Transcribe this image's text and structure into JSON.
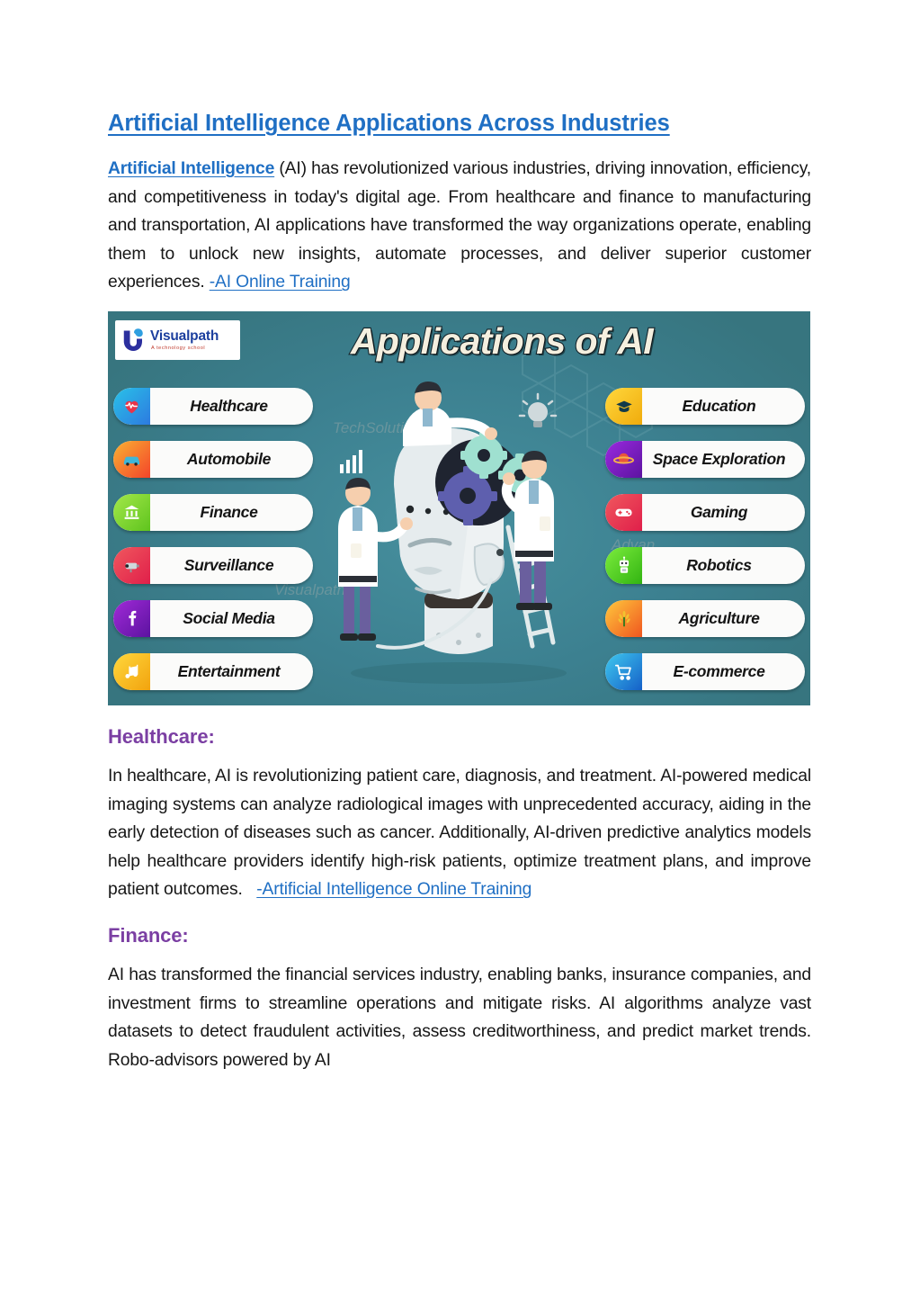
{
  "document": {
    "title": "Artificial Intelligence Applications Across Industries",
    "intro": {
      "link_lead": "Artificial Intelligence",
      "text": " (AI) has revolutionized various industries, driving innovation, efficiency, and competitiveness in today's digital age. From healthcare and finance to manufacturing and transportation, AI applications have transformed the way organizations operate, enabling them to unlock new insights, automate processes, and deliver superior customer experiences. ",
      "link_trail": "-AI Online Training"
    },
    "sections": [
      {
        "heading": "Healthcare:",
        "text": "In healthcare, AI is revolutionizing patient care, diagnosis, and treatment. AI-powered medical imaging systems can analyze radiological images with unprecedented accuracy, aiding in the early detection of diseases such as cancer. Additionally, AI-driven predictive analytics models help healthcare providers identify high-risk patients, optimize treatment plans, and improve patient outcomes.",
        "link_trail": "-Artificial Intelligence Online Training"
      },
      {
        "heading": "Finance:",
        "text": "AI has transformed the financial services industry, enabling banks, insurance companies, and investment firms to streamline operations and mitigate risks. AI algorithms analyze vast datasets to detect fraudulent activities, assess creditworthiness, and predict market trends. Robo-advisors powered by AI",
        "link_trail": ""
      }
    ]
  },
  "infographic": {
    "title": "Applications of AI",
    "logo": {
      "name": "Visualpath",
      "tagline": "A technology school",
      "mark": "v-logo-icon"
    },
    "background_color": "#3E8391",
    "left_items": [
      {
        "label": "Healthcare",
        "icon": "heart-pulse-icon",
        "color": "#1e9bd7",
        "glyph": "♥"
      },
      {
        "label": "Automobile",
        "icon": "car-icon",
        "color": "#f4622a",
        "glyph": "🚗"
      },
      {
        "label": "Finance",
        "icon": "bank-icon",
        "color": "#7ed321",
        "glyph": "🏛"
      },
      {
        "label": "Surveillance",
        "icon": "cctv-camera-icon",
        "color": "#e8344a",
        "glyph": "📹"
      },
      {
        "label": "Social Media",
        "icon": "facebook-icon",
        "color": "#7b1fa2",
        "glyph": "f"
      },
      {
        "label": "Entertainment",
        "icon": "music-note-icon",
        "color": "#f5c518",
        "glyph": "♫"
      }
    ],
    "right_items": [
      {
        "label": "Education",
        "icon": "graduation-cap-icon",
        "color": "#f9c716",
        "glyph": "🎓"
      },
      {
        "label": "Space Exploration",
        "icon": "planet-icon",
        "color": "#7d16c9",
        "glyph": "🪐"
      },
      {
        "label": "Gaming",
        "icon": "gamepad-icon",
        "color": "#e8344a",
        "glyph": "🎮"
      },
      {
        "label": "Robotics",
        "icon": "robot-icon",
        "color": "#4ecb2e",
        "glyph": "🤖"
      },
      {
        "label": "Agriculture",
        "icon": "wheat-icon",
        "color": "#f4742a",
        "glyph": "🌾"
      },
      {
        "label": "E-commerce",
        "icon": "shopping-cart-icon",
        "color": "#1e7fd7",
        "glyph": "🛒"
      }
    ],
    "illustration": "ai-robot-head-with-scientists-illustration"
  },
  "colors": {
    "link_blue": "#1F6FC4",
    "heading_purple": "#7B3FA3",
    "body_text": "#161616",
    "infographic_teal": "#3E8391"
  }
}
